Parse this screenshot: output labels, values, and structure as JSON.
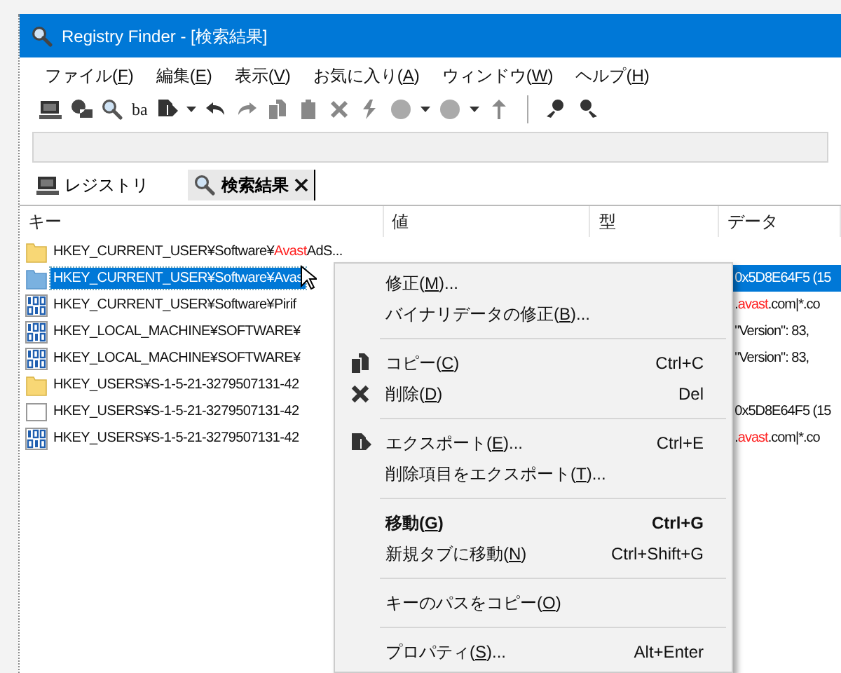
{
  "window": {
    "title": "Registry Finder - [検索結果]"
  },
  "menu": [
    {
      "start": "ファイル(",
      "accel": "F",
      "end": ")"
    },
    {
      "start": "編集(",
      "accel": "E",
      "end": ")"
    },
    {
      "start": "表示(",
      "accel": "V",
      "end": ")"
    },
    {
      "start": "お気に入り(",
      "accel": "A",
      "end": ")"
    },
    {
      "start": "ウィンドウ(",
      "accel": "W",
      "end": ")"
    },
    {
      "start": "ヘルプ(",
      "accel": "H",
      "end": ")"
    }
  ],
  "toolbar": {
    "case_label": "ba"
  },
  "tabs": [
    {
      "label": "レジストリ",
      "selected": false
    },
    {
      "label": "検索結果",
      "selected": true
    }
  ],
  "columns": [
    "キー",
    "値",
    "型",
    "データ"
  ],
  "rows": [
    {
      "kind": "folder",
      "selected": false,
      "key": [
        {
          "text": "HKEY_CURRENT_USER¥Software¥",
          "match": false
        },
        {
          "text": "Avast",
          "match": true
        },
        {
          "text": "AdS...",
          "match": false
        }
      ],
      "data": []
    },
    {
      "kind": "folder",
      "selected": true,
      "key": [
        {
          "text": "HKEY_CURRENT_USER¥Software¥Avas",
          "match": false
        }
      ],
      "data": [
        {
          "text": "0x5D8E64F5 (15",
          "match": false
        }
      ]
    },
    {
      "kind": "binary",
      "selected": false,
      "key": [
        {
          "text": "HKEY_CURRENT_USER¥Software¥Pirif",
          "match": false
        }
      ],
      "data": [
        {
          "text": ".",
          "match": false
        },
        {
          "text": "avast",
          "match": true
        },
        {
          "text": ".com|*.co",
          "match": false
        }
      ]
    },
    {
      "kind": "binary",
      "selected": false,
      "key": [
        {
          "text": "HKEY_LOCAL_MACHINE¥SOFTWARE¥",
          "match": false
        }
      ],
      "data": [
        {
          "text": "\"Version\": 83,",
          "match": false
        }
      ]
    },
    {
      "kind": "binary",
      "selected": false,
      "key": [
        {
          "text": "HKEY_LOCAL_MACHINE¥SOFTWARE¥",
          "match": false
        }
      ],
      "data": [
        {
          "text": "\"Version\": 83,",
          "match": false
        }
      ]
    },
    {
      "kind": "folder",
      "selected": false,
      "key": [
        {
          "text": "HKEY_USERS¥S-1-5-21-3279507131-42",
          "match": false
        }
      ],
      "data": []
    },
    {
      "kind": "blank",
      "selected": false,
      "key": [
        {
          "text": "HKEY_USERS¥S-1-5-21-3279507131-42",
          "match": false
        }
      ],
      "data": [
        {
          "text": "0x5D8E64F5 (15",
          "match": false
        }
      ]
    },
    {
      "kind": "binary",
      "selected": false,
      "key": [
        {
          "text": "HKEY_USERS¥S-1-5-21-3279507131-42",
          "match": false
        }
      ],
      "data": [
        {
          "text": ".",
          "match": false
        },
        {
          "text": "avast",
          "match": true
        },
        {
          "text": ".com|*.co",
          "match": false
        }
      ]
    }
  ],
  "context_menu": [
    {
      "kind": "item",
      "bold": false,
      "start": "修正(",
      "accel": "M",
      "end": ")..."
    },
    {
      "kind": "item",
      "bold": false,
      "start": "バイナリデータの修正(",
      "accel": "B",
      "end": ")..."
    },
    {
      "kind": "separator"
    },
    {
      "kind": "item",
      "bold": false,
      "start": "コピー(",
      "accel": "C",
      "end": ")",
      "shortcut": "Ctrl+C"
    },
    {
      "kind": "item",
      "bold": false,
      "start": "削除(",
      "accel": "D",
      "end": ")",
      "shortcut": "Del"
    },
    {
      "kind": "separator"
    },
    {
      "kind": "item",
      "bold": false,
      "start": "エクスポート(",
      "accel": "E",
      "end": ")...",
      "shortcut": "Ctrl+E"
    },
    {
      "kind": "item",
      "bold": false,
      "start": "削除項目をエクスポート(",
      "accel": "T",
      "end": ")..."
    },
    {
      "kind": "separator"
    },
    {
      "kind": "item",
      "bold": true,
      "start": "移動(",
      "accel": "G",
      "end": ")",
      "shortcut": "Ctrl+G"
    },
    {
      "kind": "item",
      "bold": false,
      "start": "新規タブに移動(",
      "accel": "N",
      "end": ")",
      "shortcut": "Ctrl+Shift+G"
    },
    {
      "kind": "separator"
    },
    {
      "kind": "item",
      "bold": false,
      "start": "キーのパスをコピー(",
      "accel": "O",
      "end": ")"
    },
    {
      "kind": "separator"
    },
    {
      "kind": "item",
      "bold": false,
      "start": "プロパティ(",
      "accel": "S",
      "end": ")...",
      "shortcut": "Alt+Enter"
    }
  ]
}
